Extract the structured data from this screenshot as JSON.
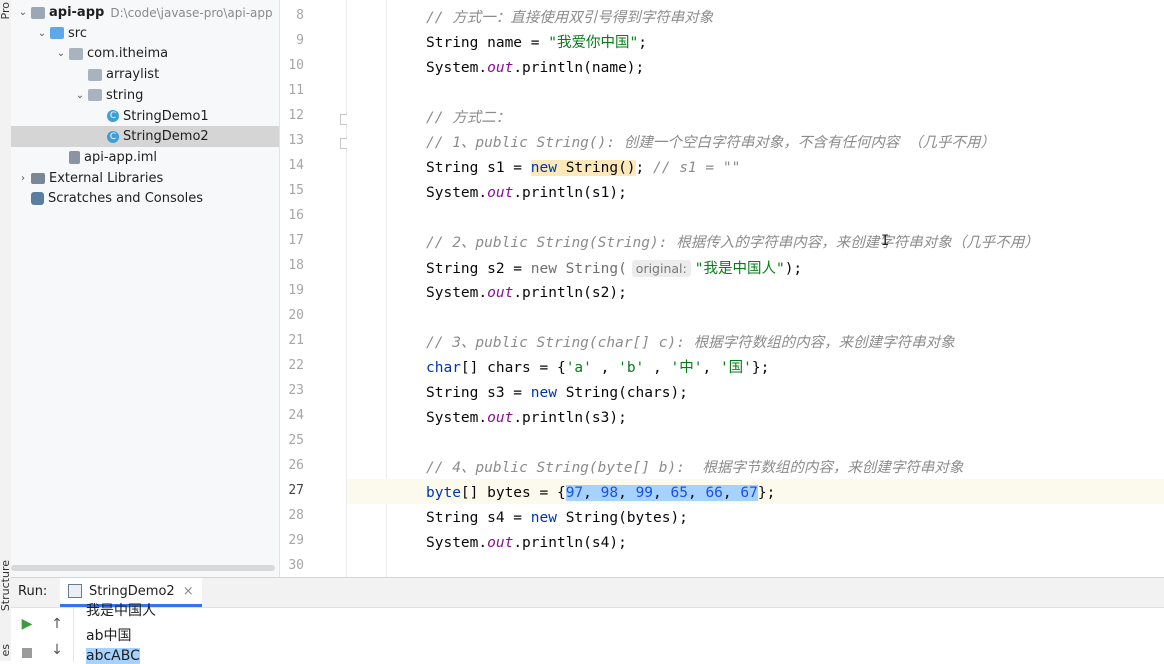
{
  "side_tabs": {
    "project": "Pro",
    "structure": "Structure",
    "bookmarks": "es"
  },
  "project_tree": [
    {
      "label": "api-app",
      "path": "D:\\code\\javase-pro\\api-app",
      "indent": 0,
      "arrow": "v",
      "icon": "module-folder-icon",
      "bold": true
    },
    {
      "label": "src",
      "indent": 1,
      "arrow": "v",
      "icon": "source-folder-icon"
    },
    {
      "label": "com.itheima",
      "indent": 2,
      "arrow": "v",
      "icon": "package-icon"
    },
    {
      "label": "arraylist",
      "indent": 3,
      "arrow": "",
      "icon": "package-icon"
    },
    {
      "label": "string",
      "indent": 3,
      "arrow": "v",
      "icon": "package-icon"
    },
    {
      "label": "StringDemo1",
      "indent": 4,
      "arrow": "",
      "icon": "java-class-icon"
    },
    {
      "label": "StringDemo2",
      "indent": 4,
      "arrow": "",
      "icon": "java-class-icon",
      "selected": true
    },
    {
      "label": "api-app.iml",
      "indent": 2,
      "arrow": "",
      "icon": "iml-file-icon"
    },
    {
      "label": "External Libraries",
      "indent": 0,
      "arrow": ">",
      "icon": "libraries-icon"
    },
    {
      "label": "Scratches and Consoles",
      "indent": 0,
      "arrow": "",
      "icon": "scratches-icon"
    }
  ],
  "editor": {
    "line_numbers": [
      "8",
      "9",
      "10",
      "11",
      "12",
      "13",
      "14",
      "15",
      "16",
      "17",
      "18",
      "19",
      "20",
      "21",
      "22",
      "23",
      "24",
      "25",
      "26",
      "27",
      "28",
      "29",
      "30"
    ],
    "current_line": "27",
    "param_hint": "original:"
  },
  "run_panel": {
    "title": "Run:",
    "tab_label": "StringDemo2",
    "close": "×",
    "output": [
      "我是中国人",
      "ab中国",
      "abcABC"
    ]
  },
  "colors": {
    "keyword": "#0033b3",
    "comment": "#8c8c8c",
    "string": "#067d17",
    "number": "#1750eb",
    "selection": "#a6d2ff",
    "accent": "#3574f0"
  }
}
